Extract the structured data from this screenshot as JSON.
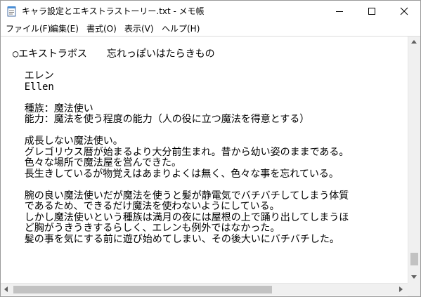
{
  "window": {
    "title": "キャラ設定とエキストラストーリー.txt - メモ帳"
  },
  "caption_buttons": {
    "minimize": "─",
    "maximize": "□",
    "close": "✕"
  },
  "menu": [
    {
      "label": "ファイル(F)"
    },
    {
      "label": "編集(E)"
    },
    {
      "label": "書式(O)"
    },
    {
      "label": "表示(V)"
    },
    {
      "label": "ヘルプ(H)"
    }
  ],
  "document": {
    "lines": [
      "  ○エキストラボス　　忘れっぽいはたらきもの",
      "",
      "    エレン",
      "    Ellen",
      "",
      "    種族：魔法使い",
      "    能力：魔法を使う程度の能力（人の役に立つ魔法を得意とする）",
      "",
      "    成長しない魔法使い。",
      "    グレゴリウス暦が始まるより大分前生まれ。昔から幼い姿のままである。",
      "    色々な場所で魔法屋を営んできた。",
      "    長生きしているが物覚えはあまりよくは無く、色々な事を忘れている。",
      "",
      "    腕の良い魔法使いだが魔法を使うと髪が静電気でバチバチしてしまう体質",
      "    であるため、できるだけ魔法を使わないようにしている。",
      "    しかし魔法使いという種族は満月の夜には屋根の上で踊り出してしまうほ",
      "    ど胸がうきうきするらしく、エレンも例外ではなかった。",
      "    髪の事を気にする前に遊び始めてしまい、その後大いにバチバチした。"
    ]
  },
  "colors": {
    "scrollbar_track": "#f0f0f0",
    "scrollbar_thumb": "#c2c2c2",
    "text": "#000000"
  }
}
